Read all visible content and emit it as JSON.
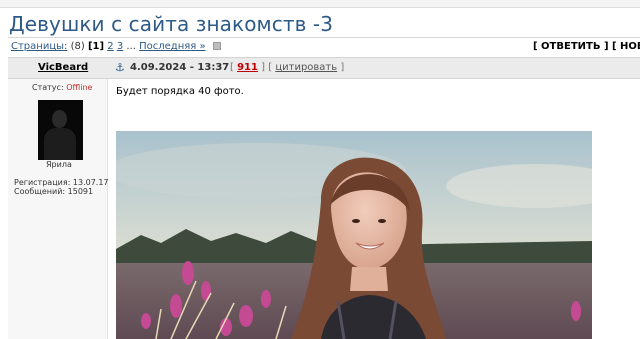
{
  "thread": {
    "title": "Девушки с сайта знакомств -3"
  },
  "pager": {
    "label": "Страницы:",
    "total": "(8)",
    "current": "[1]",
    "page2": "2",
    "page3": "3",
    "ellipsis": "...",
    "last": "Последняя »"
  },
  "actions": {
    "reply": "[ ОТВЕТИТЬ ]",
    "new": "[ НОВА"
  },
  "post": {
    "author": "VicBeard",
    "date": "4.09.2024 - 13:37",
    "number": "911",
    "quote": "цитировать",
    "text": "Будет порядка 40 фото."
  },
  "profile": {
    "status_label": "Статус:",
    "status_value": "Offline",
    "rank": "Ярила",
    "registration": "Регистрация: 13.07.17",
    "messages": "Сообщений: 15091"
  },
  "image": {
    "subject": "photo of a smiling young woman in a field of pink flowers"
  }
}
